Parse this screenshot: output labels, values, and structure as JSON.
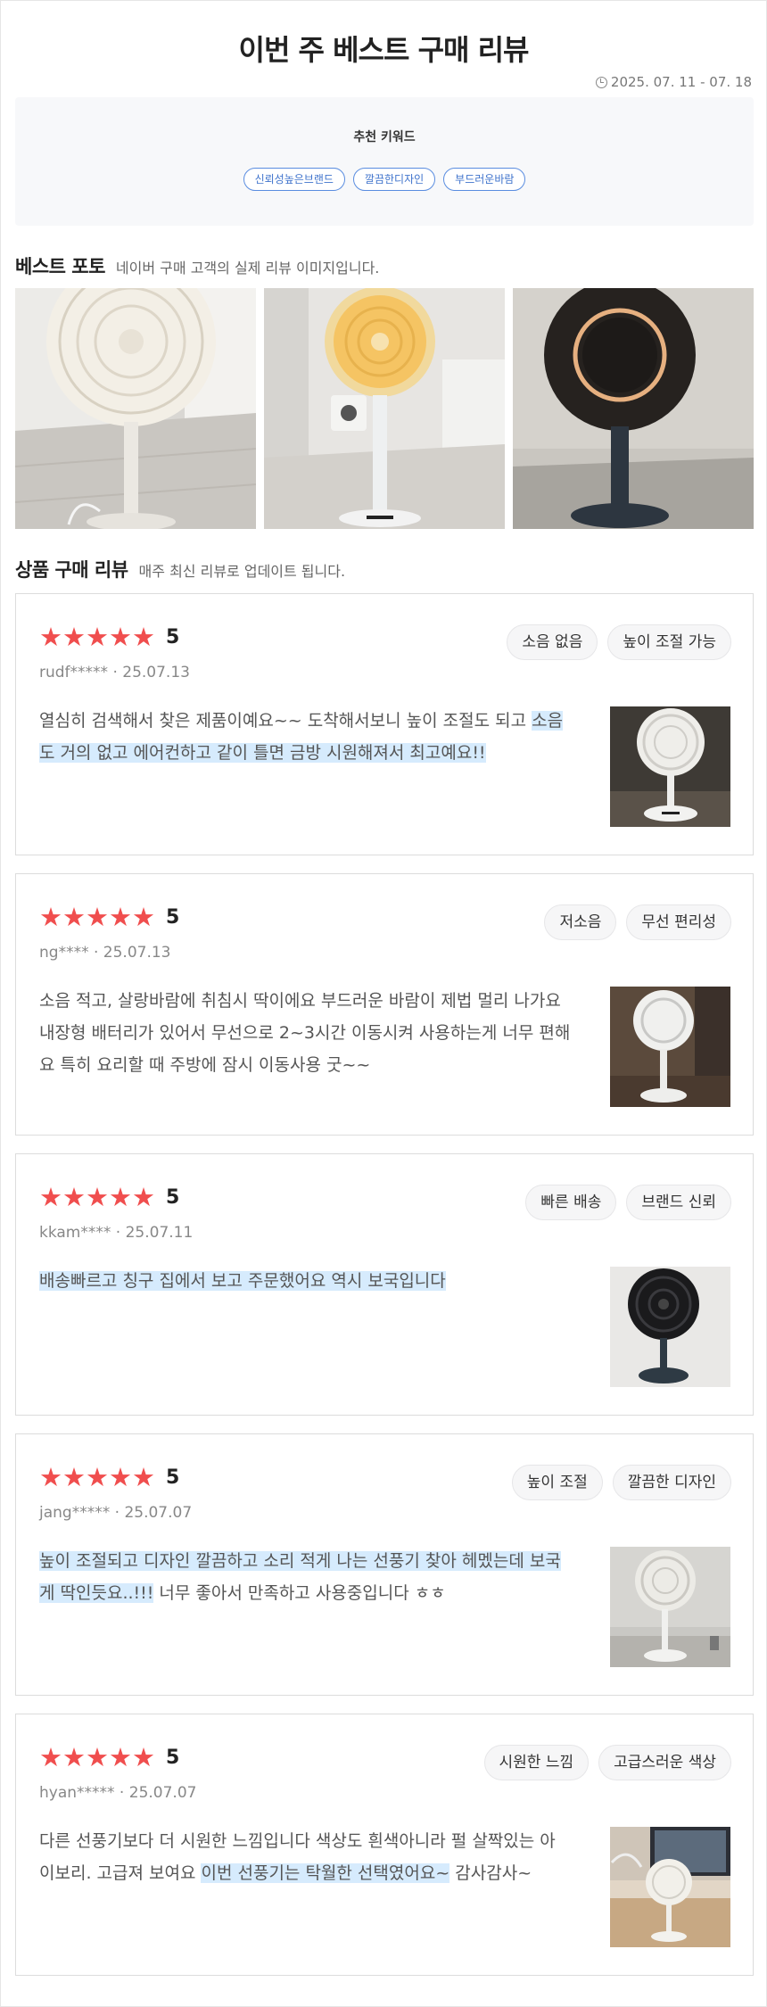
{
  "header": {
    "title": "이번 주 베스트 구매 리뷰",
    "date_range": "2025. 07. 11 - 07. 18"
  },
  "keywords": {
    "title": "추천 키워드",
    "tags": [
      "신뢰성높은브랜드",
      "깔끔한디자인",
      "부드러운바람"
    ]
  },
  "best_photo": {
    "title": "베스트 포토",
    "subtitle": "네이버 구매 고객의 실제 리뷰 이미지입니다."
  },
  "reviews_section": {
    "title": "상품 구매 리뷰",
    "subtitle": "매주 최신 리뷰로 업데이트 됩니다."
  },
  "reviews": [
    {
      "stars": "★★★★★",
      "score": "5",
      "user": "rudf*****",
      "date": "25.07.13",
      "tags": [
        "소음 없음",
        "높이 조절 가능"
      ],
      "text_plain": "열심히 검색해서 찾은 제품이예요~~ 도착해서보니 높이 조절도 되고 ",
      "text_highlight": "소음도 거의 없고 에어컨하고 같이 틀면 금방 시원해져서 최고예요!!",
      "text_after": ""
    },
    {
      "stars": "★★★★★",
      "score": "5",
      "user": "ng****",
      "date": "25.07.13",
      "tags": [
        "저소음",
        "무선 편리성"
      ],
      "text_plain": "소음 적고, 살랑바람에 취침시 딱이에요 부드러운 바람이 제법 멀리 나가요 내장형 배터리가 있어서 무선으로 2~3시간 이동시켜 사용하는게 너무 편해요 특히 요리할 때 주방에 잠시 이동사용 굿~~",
      "text_highlight": "",
      "text_after": ""
    },
    {
      "stars": "★★★★★",
      "score": "5",
      "user": "kkam****",
      "date": "25.07.11",
      "tags": [
        "빠른 배송",
        "브랜드 신뢰"
      ],
      "text_plain": "",
      "text_highlight": "배송빠르고 칭구 집에서 보고 주문했어요 역시 보국입니다",
      "text_after": ""
    },
    {
      "stars": "★★★★★",
      "score": "5",
      "user": "jang*****",
      "date": "25.07.07",
      "tags": [
        "높이 조절",
        "깔끔한 디자인"
      ],
      "text_plain": "",
      "text_highlight": "높이 조절되고 디자인 깔끔하고 소리 적게 나는 선풍기 찾아 헤멨는데 보국게 딱인듯요..!!!",
      "text_after": " 너무 좋아서 만족하고 사용중입니다 ㅎㅎ"
    },
    {
      "stars": "★★★★★",
      "score": "5",
      "user": "hyan*****",
      "date": "25.07.07",
      "tags": [
        "시원한 느낌",
        "고급스러운 색상"
      ],
      "text_plain": "다른 선풍기보다 더 시원한 느낌입니다 색상도 흰색아니라 펄 살짝있는 아이보리. 고급져 보여요 ",
      "text_highlight": "이번 선풍기는 탁월한 선택였어요~",
      "text_after": " 감사감사~"
    }
  ],
  "colors": {
    "star": "#f04e4e",
    "highlight": "#d6ebfd",
    "keyword_border": "#5a8de0"
  }
}
